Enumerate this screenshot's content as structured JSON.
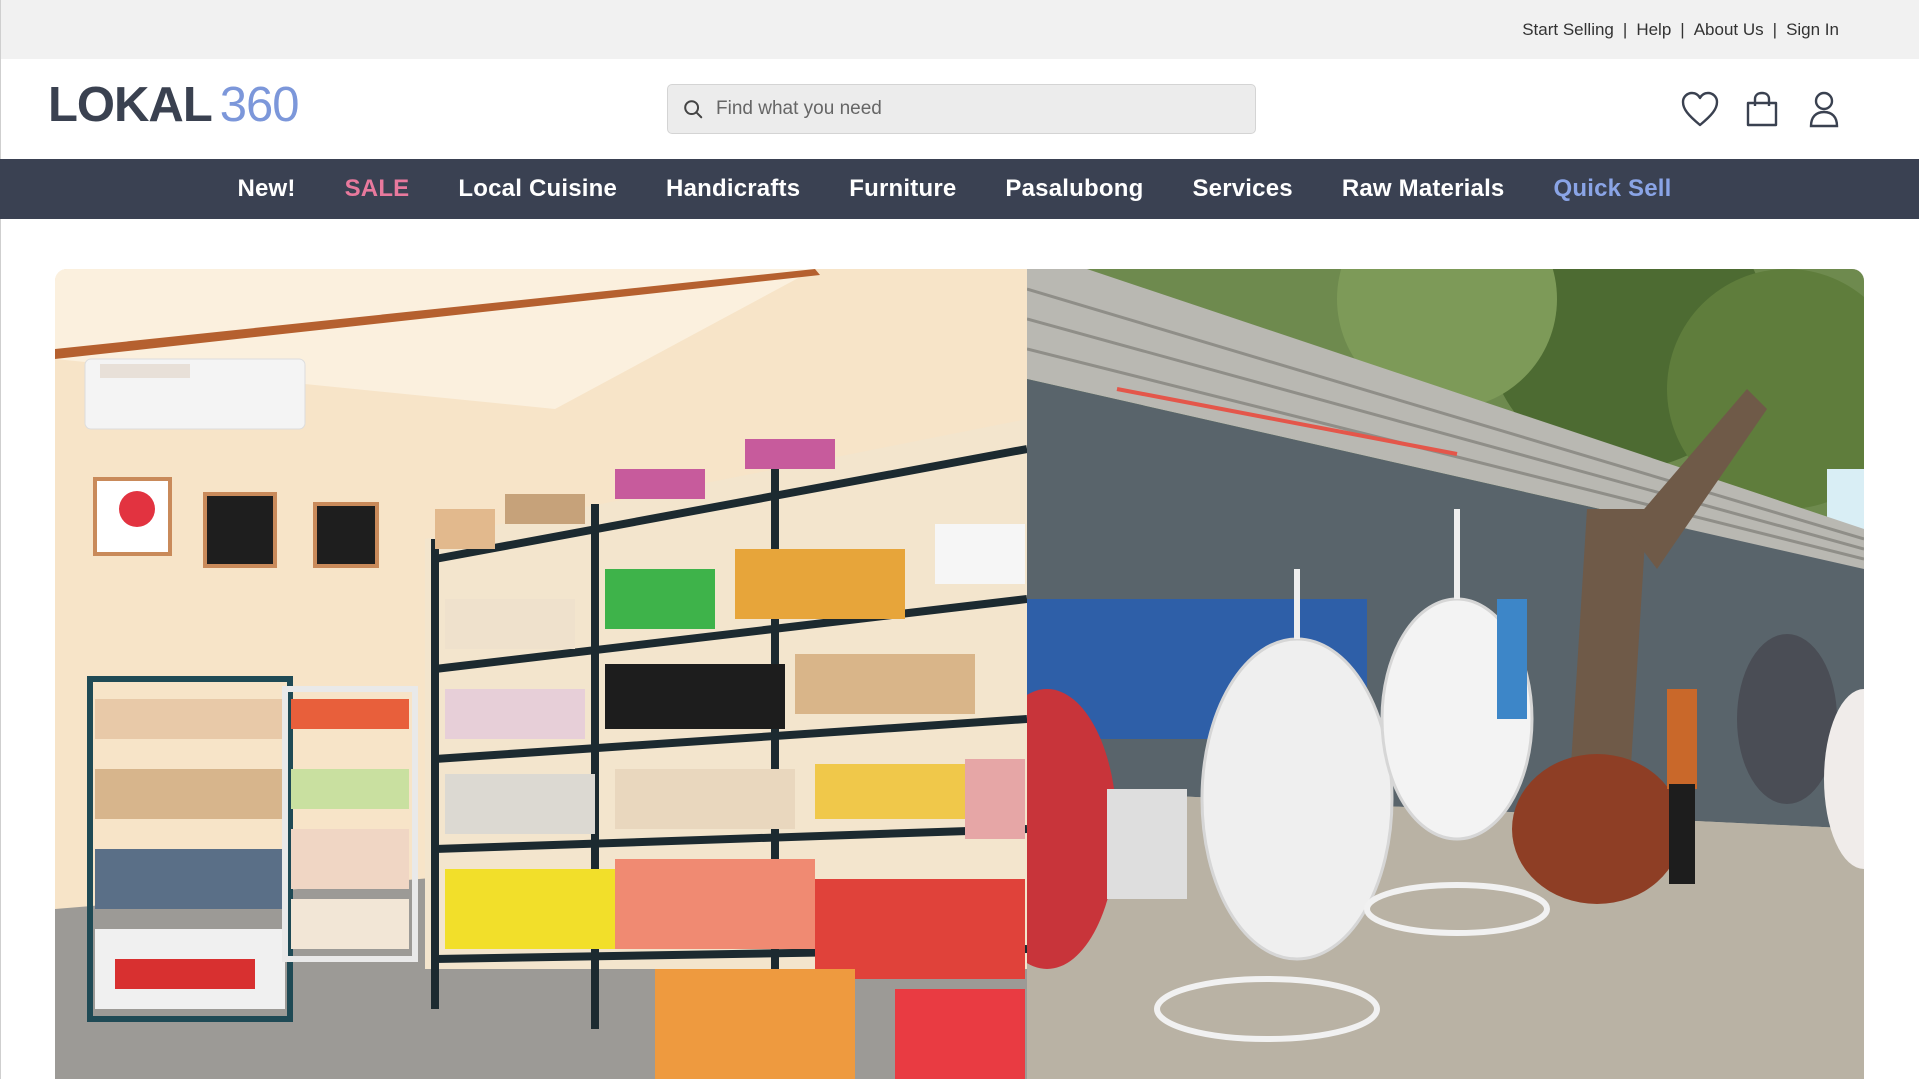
{
  "utility": {
    "links": [
      "Start Selling",
      "Help",
      "About Us",
      "Sign In"
    ],
    "separator": "|"
  },
  "brand": {
    "name": "LOKAL",
    "number": "360"
  },
  "search": {
    "placeholder": "Find what you need",
    "value": ""
  },
  "header_icons": [
    "heart-icon",
    "shopping-bag-icon",
    "user-icon"
  ],
  "nav": {
    "items": [
      "New!",
      "SALE",
      "Local Cuisine",
      "Handicrafts",
      "Furniture",
      "Pasalubong",
      "Services",
      "Raw Materials",
      "Quick Sell"
    ]
  },
  "colors": {
    "nav_bg": "#3a4152",
    "sale": "#e8799d",
    "quick_sell": "#8aa4e6",
    "logo_accent": "#7c97da"
  }
}
